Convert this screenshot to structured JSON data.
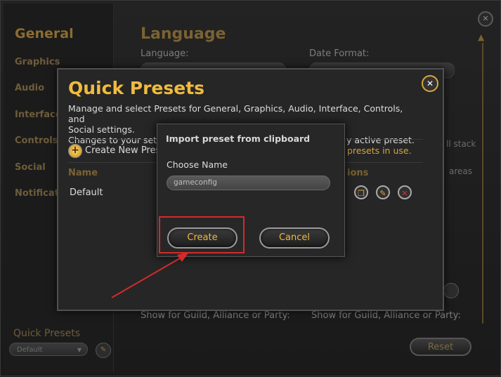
{
  "sidebar": {
    "categories": [
      "General",
      "Graphics",
      "Audio",
      "Interface",
      "Controls",
      "Social",
      "Notifications"
    ],
    "quick_presets_label": "Quick Presets",
    "preset_select_value": "Default"
  },
  "main": {
    "title": "Language",
    "language_label": "Language:",
    "date_format_label": "Date Format:",
    "side_text_1": "ll stack",
    "side_text_2": "areas",
    "show_guild_label_left": "Show for Guild, Alliance or Party:",
    "show_guild_label_right": "Show for Guild, Alliance or Party:",
    "reset_label": "Reset"
  },
  "quick_presets_dialog": {
    "title": "Quick Presets",
    "description_line1": "Manage and select Presets for General, Graphics, Audio, Interface, Controls, and",
    "description_line2": "Social settings.",
    "description_line3_left": "Changes to your sett",
    "description_line3_right": "y active preset.",
    "create_new_label": "Create New Pres",
    "presets_in_use": "presets in use.",
    "col_name": "Name",
    "col_actions": "ions",
    "rows": [
      "Default"
    ]
  },
  "import_dialog": {
    "title": "Import preset from clipboard",
    "choose_name_label": "Choose Name",
    "name_value": "gameconfig",
    "create_label": "Create",
    "cancel_label": "Cancel"
  },
  "colors": {
    "accent_gold": "#f0bb3f",
    "annotation_red": "#d42a2a"
  }
}
